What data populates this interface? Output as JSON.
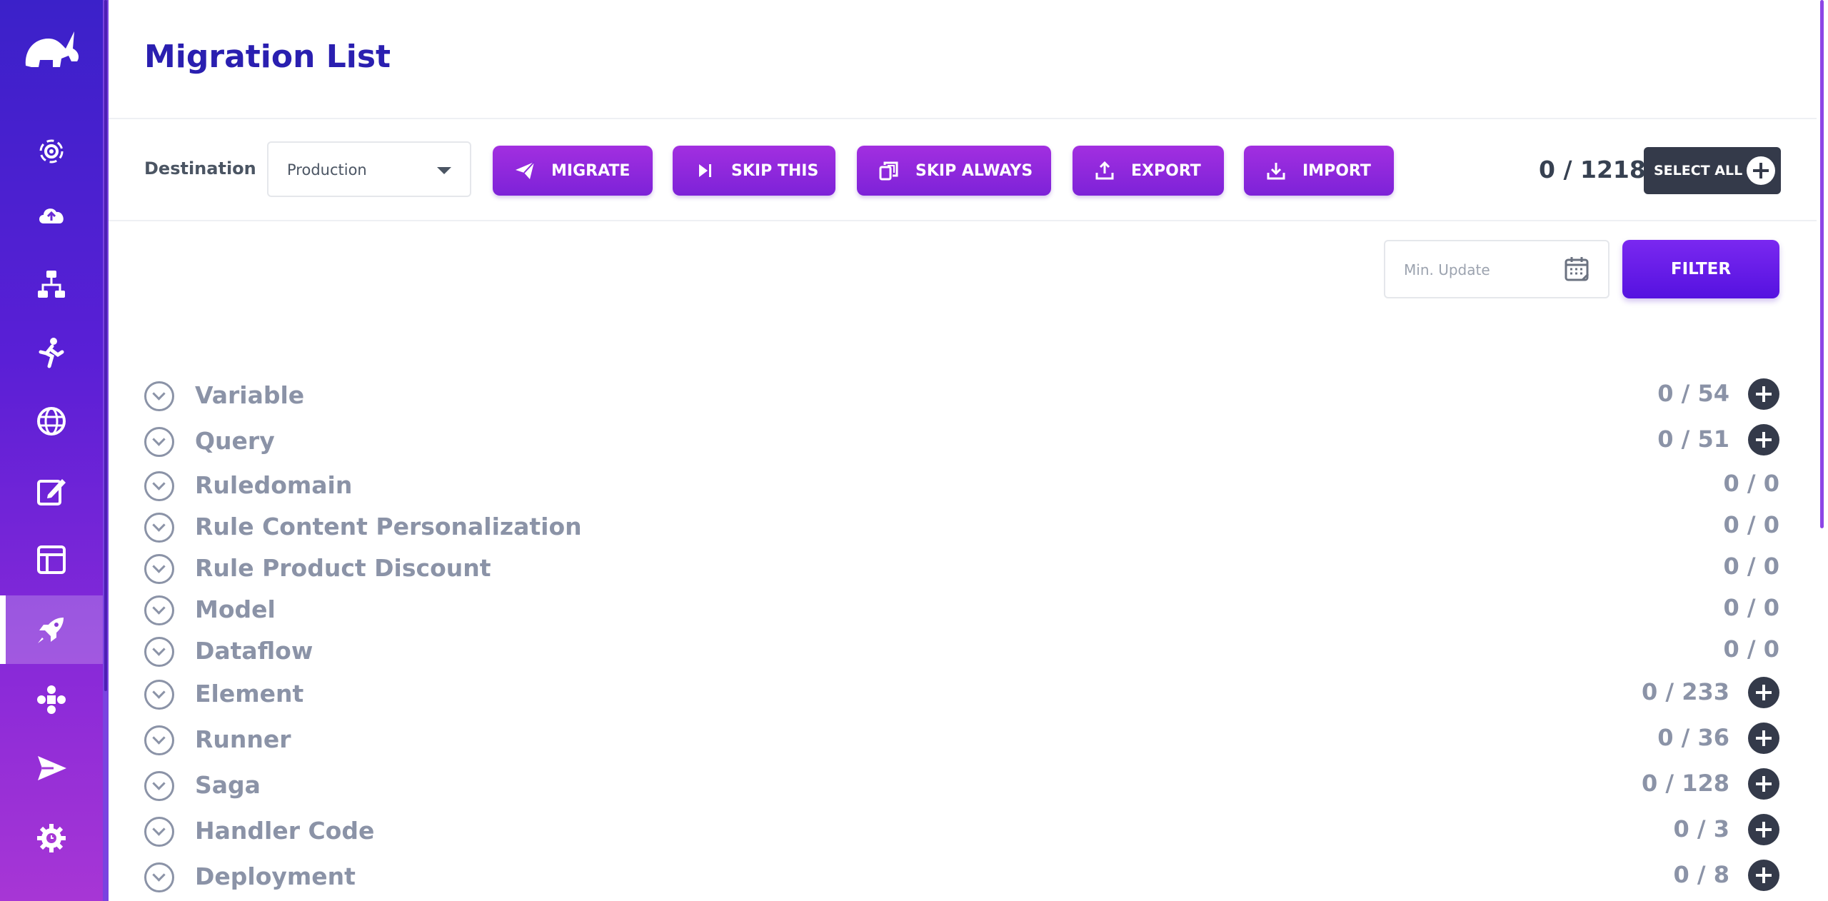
{
  "sidebar": {
    "items": [
      {
        "icon": "radar-icon"
      },
      {
        "icon": "cloud-upload-icon"
      },
      {
        "icon": "flow-icon"
      },
      {
        "icon": "runner-icon"
      },
      {
        "icon": "globe-icon"
      },
      {
        "icon": "edit-icon"
      },
      {
        "icon": "layout-icon"
      },
      {
        "icon": "rocket-icon",
        "active": true
      },
      {
        "icon": "gamepad-icon"
      },
      {
        "icon": "send-icon"
      },
      {
        "icon": "gear-clock-icon"
      }
    ]
  },
  "header": {
    "title": "Migration List"
  },
  "toolbar": {
    "destination_label": "Destination",
    "destination_value": "Production",
    "migrate_label": "MIGRATE",
    "skip_this_label": "SKIP THIS",
    "skip_always_label": "SKIP ALWAYS",
    "export_label": "EXPORT",
    "import_label": "IMPORT",
    "total_count": "0 / 1218",
    "select_all_label": "SELECT ALL"
  },
  "filter": {
    "min_update_placeholder": "Min. Update",
    "filter_label": "FILTER"
  },
  "categories": [
    {
      "name": "Variable",
      "count": "0 / 54"
    },
    {
      "name": "Query",
      "count": "0 / 51"
    },
    {
      "name": "Ruledomain",
      "count": "0 / 0"
    },
    {
      "name": "Rule Content Personalization",
      "count": "0 / 0"
    },
    {
      "name": "Rule Product Discount",
      "count": "0 / 0"
    },
    {
      "name": "Model",
      "count": "0 / 0"
    },
    {
      "name": "Dataflow",
      "count": "0 / 0"
    },
    {
      "name": "Element",
      "count": "0 / 233"
    },
    {
      "name": "Runner",
      "count": "0 / 36"
    },
    {
      "name": "Saga",
      "count": "0 / 128"
    },
    {
      "name": "Handler Code",
      "count": "0 / 3"
    },
    {
      "name": "Deployment",
      "count": "0 / 8"
    }
  ]
}
